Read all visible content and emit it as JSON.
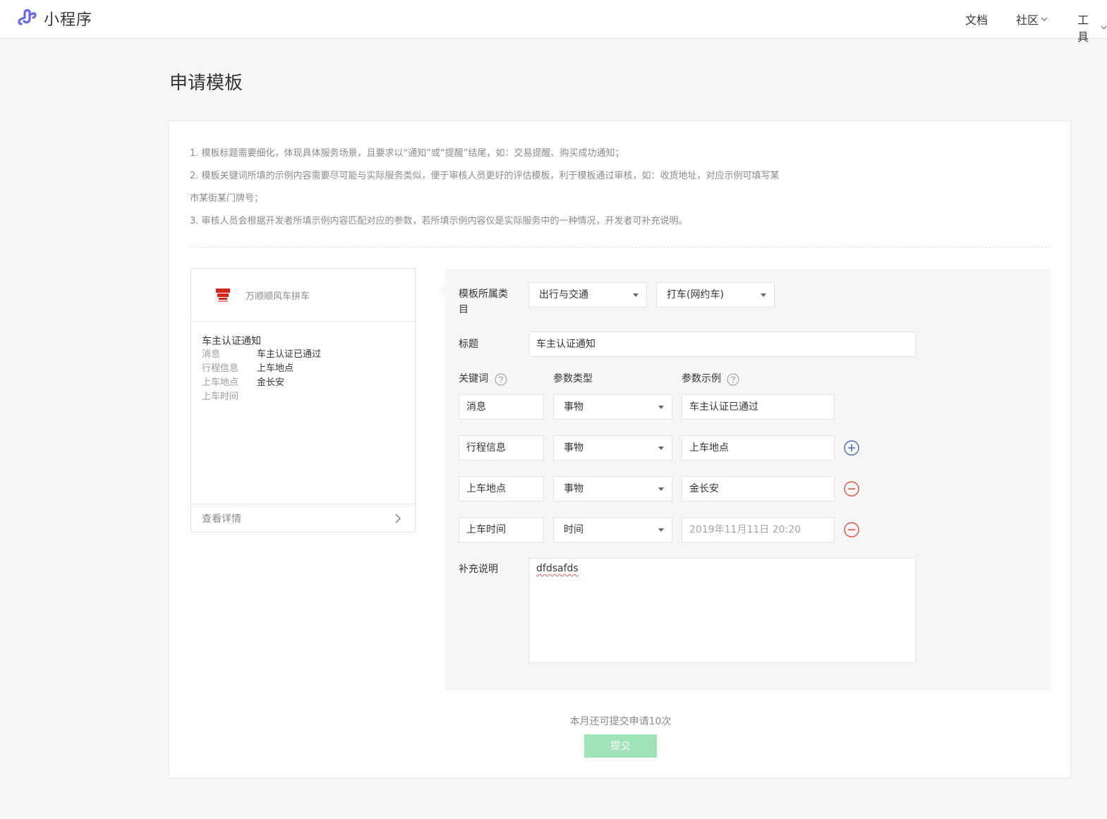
{
  "nav": {
    "brand": "小程序",
    "items": [
      "文档",
      "社区",
      "工具"
    ]
  },
  "page": {
    "title": "申请模板"
  },
  "tips": [
    "1. 模板标题需要细化，体现具体服务场景，且要求以“通知”或“提醒”结尾，如：交易提醒、购买成功通知；",
    "2. 模板关键词所填的示例内容需要尽可能与实际服务类似，便于审核人员更好的评估模板，利于模板通过审核，如：收货地址，对应示例可填写某",
    "市某街某门牌号；",
    "3. 审核人员会根据开发者所填示例内容匹配对应的参数，若所填示例内容仅是实际服务中的一种情况，开发者可补充说明。"
  ],
  "preview": {
    "app_name": "万顺顺风车拼车",
    "title": "车主认证通知",
    "rows": [
      {
        "k": "消息",
        "v": "车主认证已通过"
      },
      {
        "k": "行程信息",
        "v": "上车地点"
      },
      {
        "k": "上车地点",
        "v": "金长安"
      },
      {
        "k": "上车时间",
        "v": ""
      }
    ],
    "detail_link": "查看详情"
  },
  "form": {
    "category_label": "模板所属类目",
    "category_primary": "出行与交通",
    "category_secondary": "打车(网约车)",
    "title_label": "标题",
    "title_value": "车主认证通知",
    "col_keyword": "关键词",
    "col_type": "参数类型",
    "col_example": "参数示例",
    "keywords": [
      {
        "name": "消息",
        "type": "事物",
        "example": "车主认证已通过",
        "action": ""
      },
      {
        "name": "行程信息",
        "type": "事物",
        "example": "上车地点",
        "action": "add"
      },
      {
        "name": "上车地点",
        "type": "事物",
        "example": "金长安",
        "action": "remove"
      },
      {
        "name": "上车时间",
        "type": "时间",
        "example": "2019年11月11日 20:20",
        "action": "remove"
      }
    ],
    "supplement_label": "补充说明",
    "supplement_value": "dfdsafds"
  },
  "footer": {
    "quota_text": "本月还可提交申请10次",
    "submit_label": "提交"
  },
  "colors": {
    "accent_add": "#4a6cb3",
    "accent_remove": "#e2533c",
    "submit_disabled": "#9fe3b8",
    "brand_icon": "#6467f0"
  }
}
